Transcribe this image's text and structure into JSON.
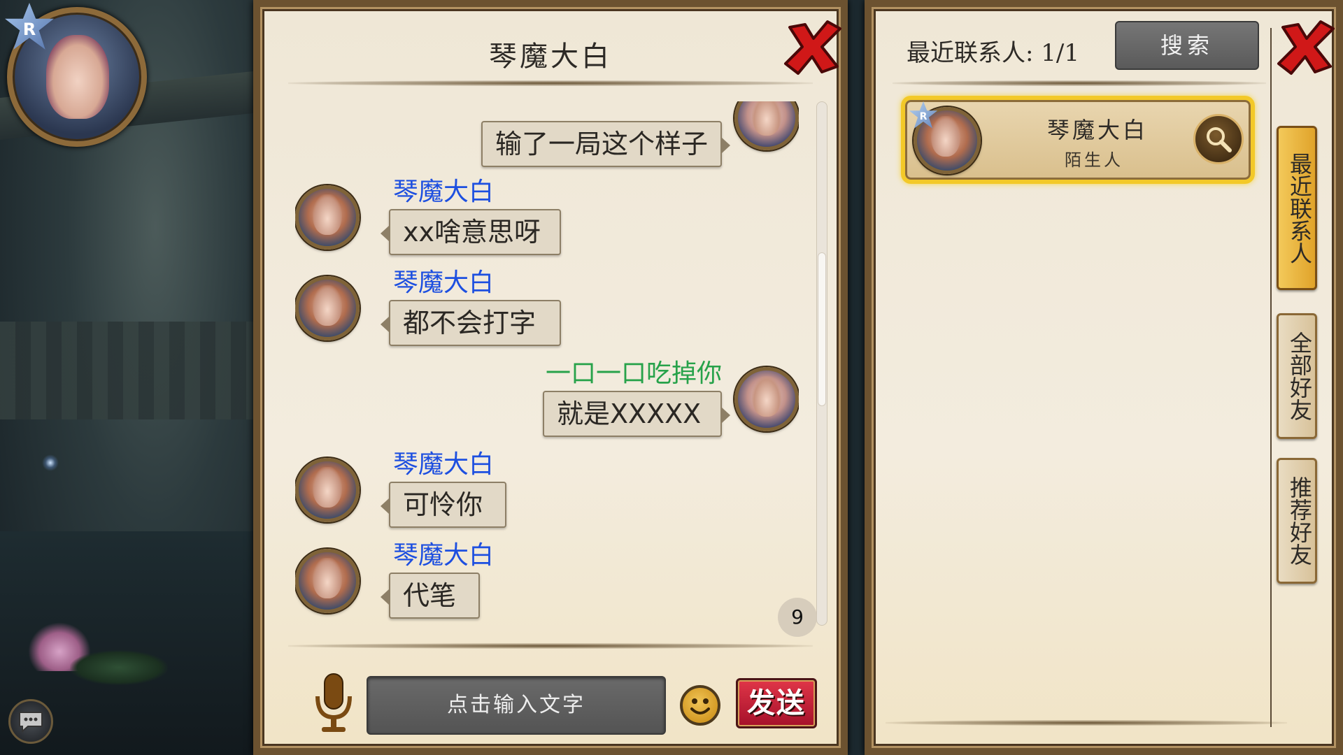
{
  "chat": {
    "title": "琴魔大白",
    "unread_count": "9",
    "input_placeholder": "点击输入文字",
    "send_label": "发送",
    "messages": [
      {
        "side": "me",
        "sender": "",
        "text": "输了一局这个样子"
      },
      {
        "side": "other",
        "sender": "琴魔大白",
        "text": "xx啥意思呀"
      },
      {
        "side": "other",
        "sender": "琴魔大白",
        "text": "都不会打字"
      },
      {
        "side": "me",
        "sender": "一口一口吃掉你",
        "text": "就是XXXXX"
      },
      {
        "side": "other",
        "sender": "琴魔大白",
        "text": "可怜你"
      },
      {
        "side": "other",
        "sender": "琴魔大白",
        "text": "代笔"
      }
    ]
  },
  "contacts": {
    "recent_label": "最近联系人: 1/1",
    "search_label": "搜索",
    "list": [
      {
        "name": "琴魔大白",
        "status": "陌生人"
      }
    ],
    "tabs": [
      {
        "label": "最近联系人",
        "active": true
      },
      {
        "label": "全部好友",
        "active": false
      },
      {
        "label": "推荐好友",
        "active": false
      }
    ]
  },
  "player": {
    "vip_badge": "R"
  },
  "colors": {
    "sender_other": "#1d4fe0",
    "sender_me": "#27a24a",
    "highlight": "#f3c928",
    "send_button": "#c8203a",
    "close_x": "#d01818"
  },
  "icons": [
    "close-icon",
    "microphone-icon",
    "emoji-icon",
    "magnifier-icon",
    "chat-bubble-icon",
    "vip-star-icon"
  ]
}
